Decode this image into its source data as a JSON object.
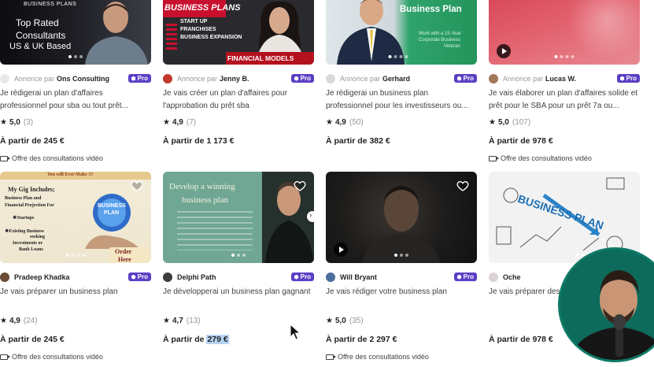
{
  "gigs": [
    {
      "seller": "Ons Consulting",
      "annonce": "Annonce par",
      "pro": "Pro",
      "title": "Je rédigerai un plan d'affaires professionnel pour sba ou tout prêt...",
      "rating": "5,0",
      "reviews": "(3)",
      "price_prefix": "À partir de ",
      "price": "245 €",
      "video": "Offre des consultations vidéo",
      "thumb_lines": [
        "BUSINESS PLANS",
        "Top Rated",
        "Consultants",
        "US & UK Based"
      ],
      "icon": "heart-icon"
    },
    {
      "seller": "Jenny B.",
      "annonce": "Annonce par",
      "pro": "Pro",
      "title": "Je vais créer un plan d'affaires pour l'approbation du prêt sba",
      "rating": "4,9",
      "reviews": "(7)",
      "price_prefix": "À partir de ",
      "price": "1 173 €",
      "video": "",
      "thumb_lines": [
        "BUSINESS PLANS",
        "START UP",
        "FRANCHISES",
        "BUSINESS EXPANSION",
        "FINANCIAL MODELS"
      ]
    },
    {
      "seller": "Gerhard",
      "annonce": "Annonce par",
      "pro": "Pro",
      "title": "Je rédigerai un business plan professionnel pour les investisseurs ou...",
      "rating": "4,9",
      "reviews": "(50)",
      "price_prefix": "À partir de ",
      "price": "382 €",
      "video": "",
      "thumb_lines": [
        "Business Plan",
        "Work with a 15-Year",
        "Corporate Business",
        "Veteran"
      ]
    },
    {
      "seller": "Lucas W.",
      "annonce": "Annonce par",
      "pro": "Pro",
      "title": "Je vais élaborer un plan d'affaires solide et prêt pour le SBA pour un prêt 7a ou...",
      "rating": "5,0",
      "reviews": "(107)",
      "price_prefix": "À partir de ",
      "price": "978 €",
      "video": "Offre des consultations vidéo",
      "thumb_lines": []
    },
    {
      "seller": "Pradeep Khadka",
      "annonce": "",
      "pro": "Pro",
      "title": "Je vais préparer un business plan",
      "rating": "4,9",
      "reviews": "(24)",
      "price_prefix": "À partir de ",
      "price": "245 €",
      "video": "Offre des consultations vidéo",
      "thumb_lines": [
        "You will Ever Make !!!",
        "My Gig Includes;",
        "Business Plan and",
        "Financial Projection For",
        "❖Startups",
        "❖Existing Business",
        "seeking",
        "Investments or",
        "Bank Loans",
        "BUSINESS",
        "PLAN",
        "Order",
        "Here"
      ]
    },
    {
      "seller": "Delphi Path",
      "annonce": "",
      "pro": "Pro",
      "title": "Je développerai un business plan gagnant",
      "rating": "4,7",
      "reviews": "(13)",
      "price_prefix": "À partir de ",
      "price": "279 €",
      "video": "",
      "thumb_lines": [
        "Develop a winning",
        "business plan"
      ]
    },
    {
      "seller": "Will Bryant",
      "annonce": "",
      "pro": "Pro",
      "title": "Je vais rédiger votre business plan",
      "rating": "5,0",
      "reviews": "(35)",
      "price_prefix": "À partir de ",
      "price": "2 297 €",
      "video": "Offre des consultations vidéo",
      "thumb_lines": []
    },
    {
      "seller": "Oche",
      "annonce": "",
      "pro": "",
      "title": "Je vais préparer des... pour vous",
      "rating": "",
      "reviews": "",
      "price_prefix": "À partir de ",
      "price": "978 €",
      "video": "",
      "thumb_lines": [
        "BUSINESS PLAN"
      ]
    }
  ],
  "colors": {
    "pro_badge": "#5b3fc4",
    "highlight": "#b7d3f2",
    "webcam_bg": "#0d6b5b"
  }
}
